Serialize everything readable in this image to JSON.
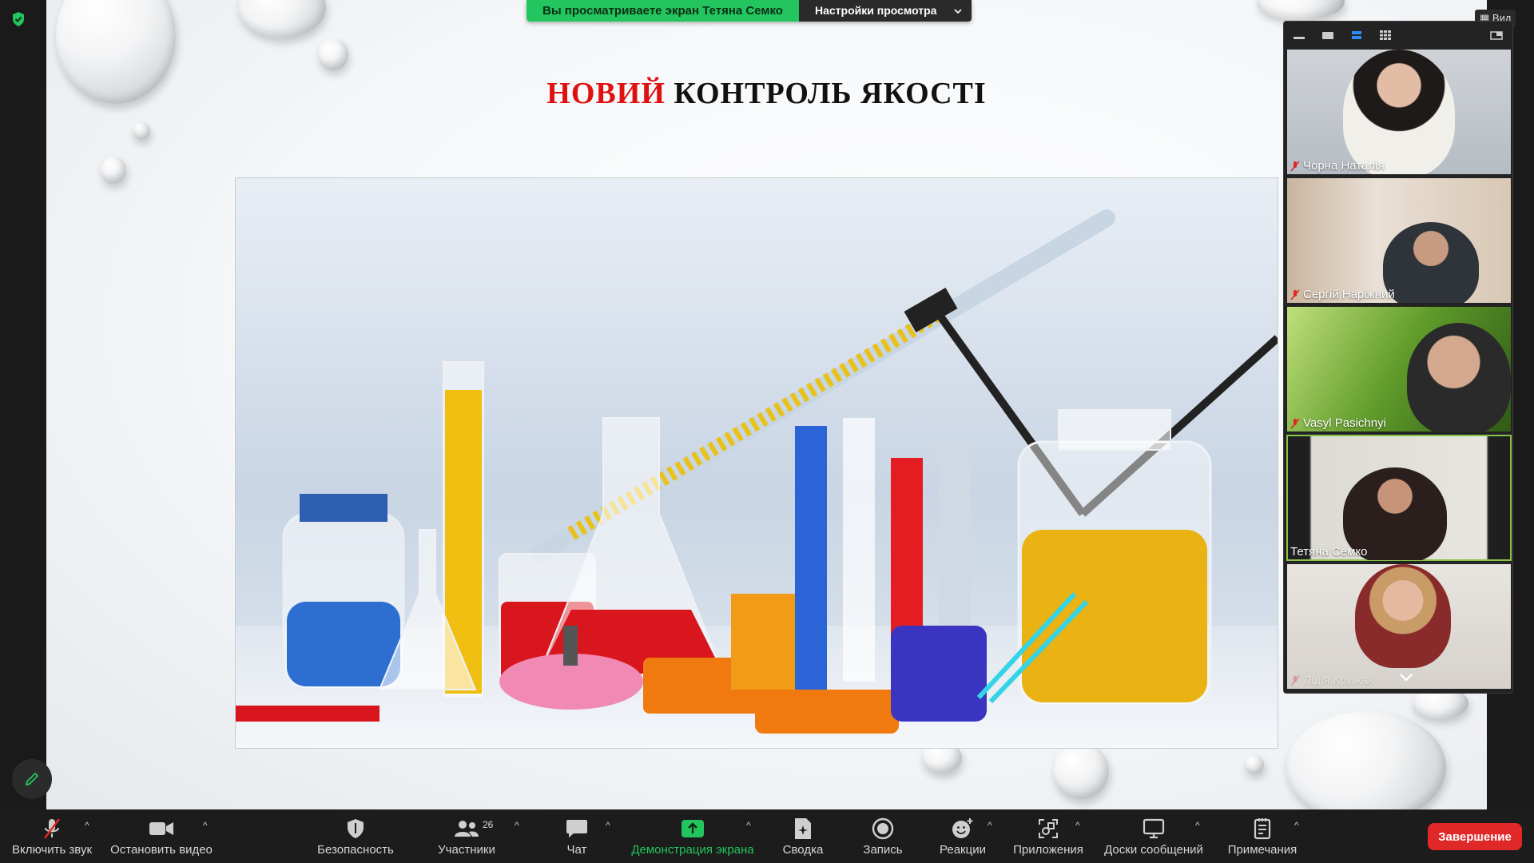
{
  "banner": {
    "viewing_text": "Вы просматриваете экран Тетяна Семко",
    "options_label": "Настройки просмотра"
  },
  "view_button": {
    "label": "Вид"
  },
  "slide": {
    "title_red": "НОВИЙ",
    "title_rest": " КОНТРОЛЬ ЯКОСТІ"
  },
  "gallery": {
    "participants": [
      {
        "name": "Чорна Наталія",
        "muted": true
      },
      {
        "name": "Сергій Наріжний",
        "muted": true
      },
      {
        "name": "Vasyl Pasichnyi",
        "muted": true
      },
      {
        "name": "Тетяна Семко",
        "muted": false,
        "active": true
      },
      {
        "name": "Лідія Крижак",
        "muted": true
      }
    ]
  },
  "toolbar": {
    "unmute": "Включить звук",
    "stop_video": "Остановить видео",
    "security": "Безопасность",
    "participants": "Участники",
    "participants_count": "26",
    "chat": "Чат",
    "share_screen": "Демонстрация экрана",
    "summary": "Сводка",
    "record": "Запись",
    "reactions": "Реакции",
    "apps": "Приложения",
    "whiteboards": "Доски сообщений",
    "notes": "Примечания",
    "end": "Завершение"
  },
  "colors": {
    "accent_green": "#22c55e",
    "end_red": "#e02828",
    "title_red": "#e01010"
  }
}
